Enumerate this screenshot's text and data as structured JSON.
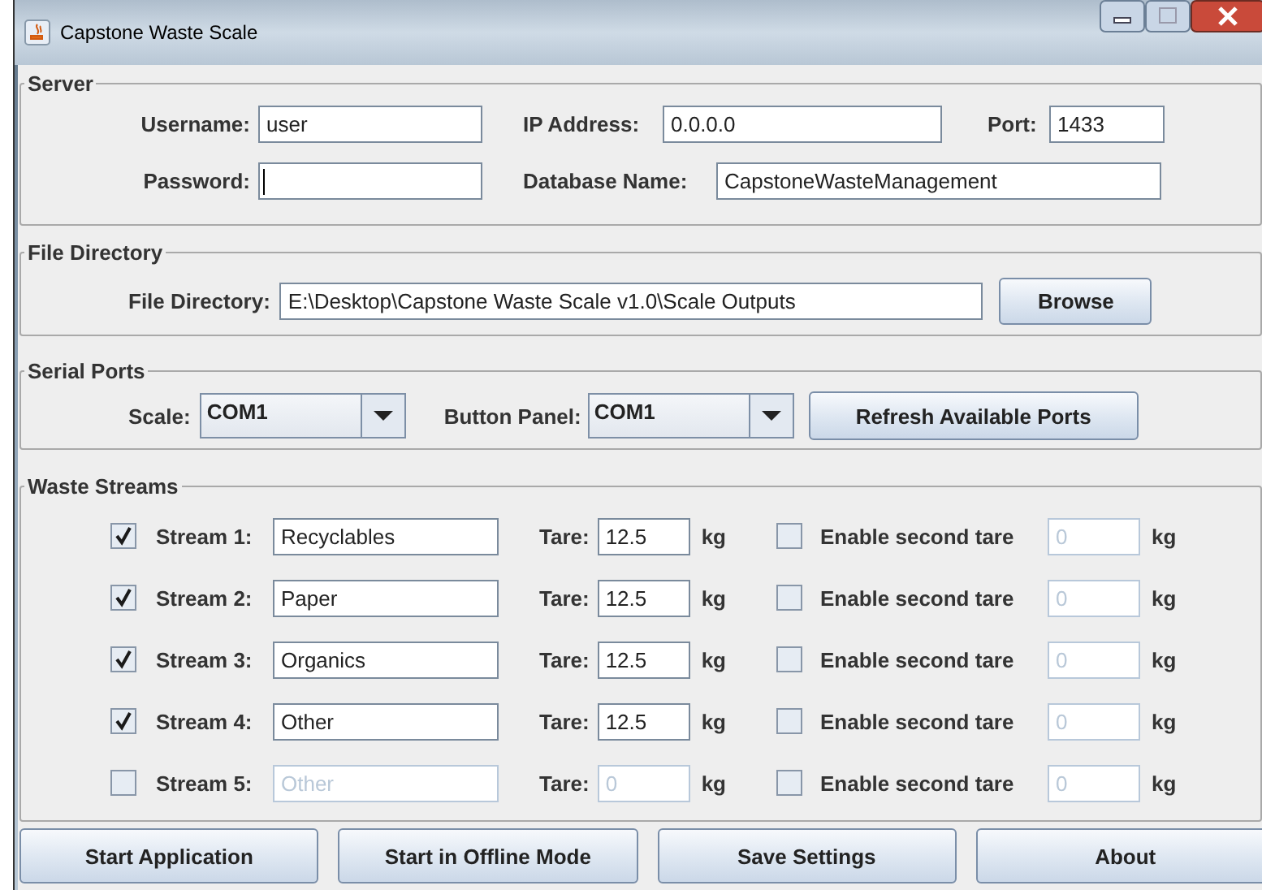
{
  "window": {
    "title": "Capstone Waste Scale"
  },
  "server": {
    "title": "Server",
    "fields": [
      {
        "label": "Username:",
        "value": "user"
      },
      {
        "label": "IP Address:",
        "value": "0.0.0.0"
      },
      {
        "label": "Port:",
        "value": "1433"
      },
      {
        "label": "Password:",
        "focused": true
      },
      {
        "label": "Database Name:",
        "value": "CapstoneWasteManagement"
      }
    ]
  },
  "file_directory": {
    "title": "File Directory",
    "label": "File Directory:",
    "value": "E:\\Desktop\\Capstone Waste Scale v1.0\\Scale Outputs",
    "button": "Browse"
  },
  "serial_ports": {
    "title": "Serial Ports",
    "scale_label": "Scale:",
    "scale_value": "COM1",
    "panel_label": "Button Panel:",
    "panel_value": "COM1",
    "button": "Refresh Available Ports"
  },
  "waste_streams": {
    "title": "Waste Streams",
    "streams": [
      {
        "checked": true,
        "label": "Stream 1:",
        "name": "Recyclables",
        "tare_label": "Tare:",
        "tare": "12.5",
        "unit": "kg",
        "second_checked": false,
        "second_label": "Enable second tare",
        "second_tare": "0",
        "second_unit": "kg"
      },
      {
        "checked": true,
        "label": "Stream 2:",
        "name": "Paper",
        "tare_label": "Tare:",
        "tare": "12.5",
        "unit": "kg",
        "second_checked": false,
        "second_label": "Enable second tare",
        "second_tare": "0",
        "second_unit": "kg"
      },
      {
        "checked": true,
        "label": "Stream 3:",
        "name": "Organics",
        "tare_label": "Tare:",
        "tare": "12.5",
        "unit": "kg",
        "second_checked": false,
        "second_label": "Enable second tare",
        "second_tare": "0",
        "second_unit": "kg"
      },
      {
        "checked": true,
        "label": "Stream 4:",
        "name": "Other",
        "tare_label": "Tare:",
        "tare": "12.5",
        "unit": "kg",
        "second_checked": false,
        "second_label": "Enable second tare",
        "second_tare": "0",
        "second_unit": "kg"
      },
      {
        "checked": false,
        "label": "Stream 5:",
        "name": "Other",
        "tare_label": "Tare:",
        "tare": "0",
        "unit": "kg",
        "second_checked": false,
        "second_label": "Enable second tare",
        "second_tare": "0",
        "second_unit": "kg"
      }
    ]
  },
  "buttons": [
    "Start Application",
    "Start in Offline Mode",
    "Save Settings",
    "About"
  ]
}
